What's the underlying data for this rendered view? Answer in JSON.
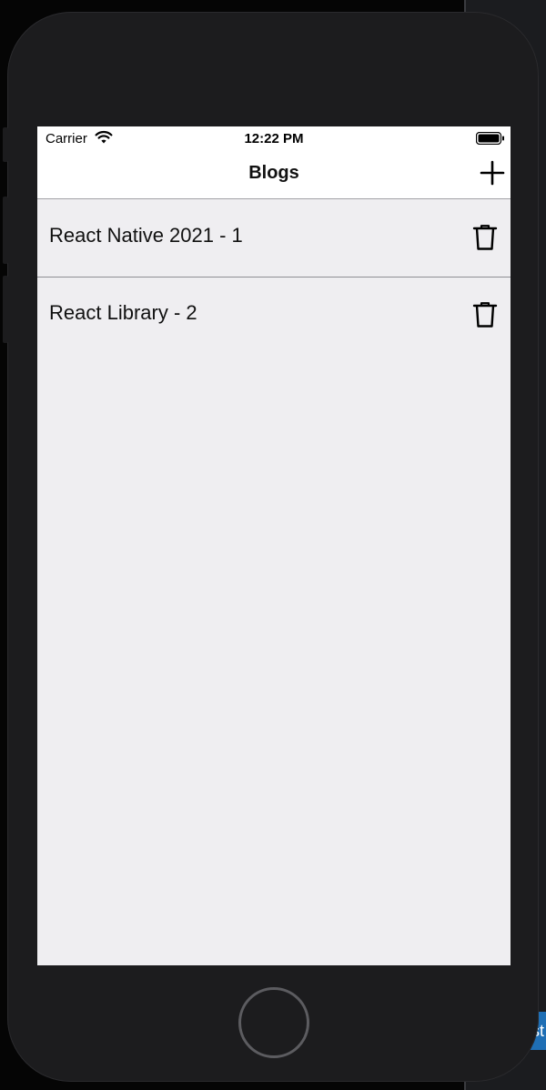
{
  "status_bar": {
    "carrier": "Carrier",
    "time": "12:22 PM",
    "wifi_icon": "wifi-icon",
    "battery_icon": "battery-full-icon"
  },
  "nav_bar": {
    "title": "Blogs",
    "add_icon": "plus-icon"
  },
  "blogs": [
    {
      "title": "React Native 2021 - 1",
      "delete_icon": "trash-icon"
    },
    {
      "title": "React Library - 2",
      "delete_icon": "trash-icon"
    }
  ],
  "desktop_fragment": {
    "text": "st"
  },
  "colors": {
    "list_background": "#efeef1",
    "bar_background": "#ffffff",
    "phone_body": "#1c1c1e",
    "separator": "#8e8e93"
  }
}
